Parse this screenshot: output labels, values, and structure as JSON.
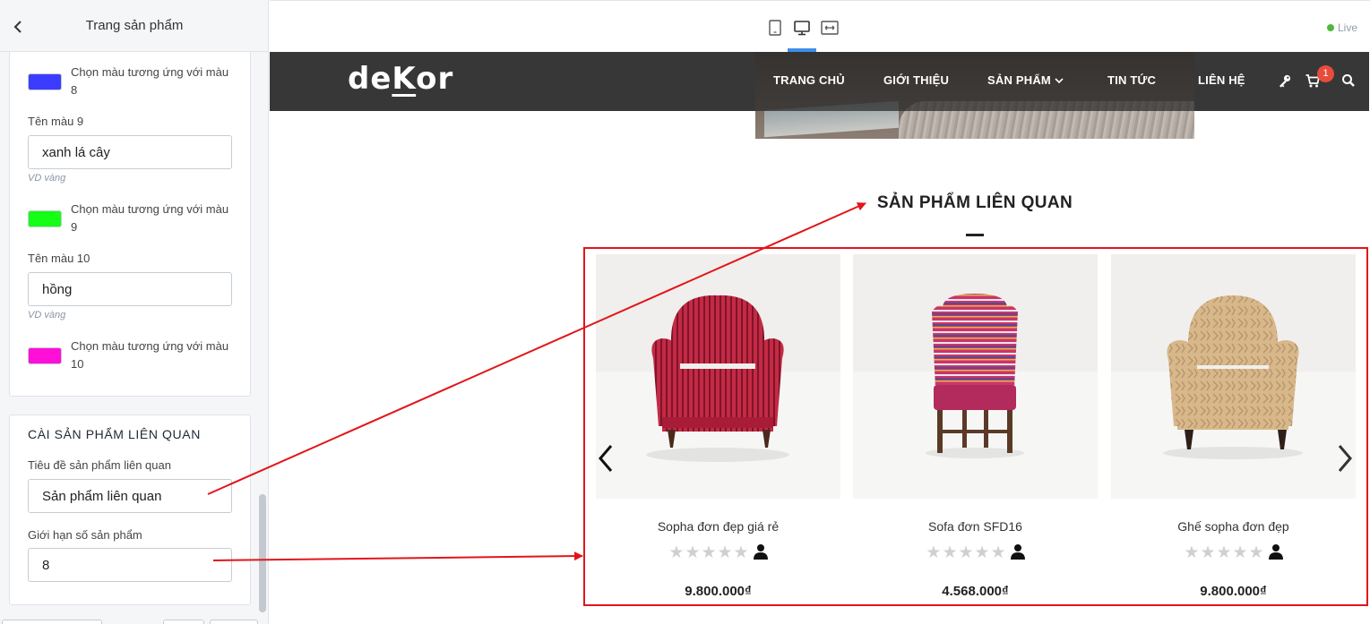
{
  "editor": {
    "header_title": "Trang sản phẩm",
    "color_rows": [
      {
        "swatch_color": "#3c3cff",
        "pick_label": "Chọn màu tương ứng với màu 8"
      },
      {
        "name_label": "Tên màu 9",
        "name_value": "xanh lá cây",
        "hint": "VD vàng",
        "swatch_color": "#14ff14",
        "pick_label": "Chọn màu tương ứng với màu 9"
      },
      {
        "name_label": "Tên màu 10",
        "name_value": "hồng",
        "hint": "VD vàng",
        "swatch_color": "#ff0fd8",
        "pick_label": "Chọn màu tương ứng với màu 10"
      }
    ],
    "related_section": {
      "heading": "CÀI SẢN PHẨM LIÊN QUAN",
      "title_label": "Tiêu đề sản phẩm liên quan",
      "title_value": "Sản phẩm liên quan",
      "limit_label": "Giới hạn số sản phẩm",
      "limit_value": "8"
    }
  },
  "toolbar": {
    "live_label": "Live",
    "device_icons": [
      "mobile-icon",
      "desktop-icon",
      "fullwidth-icon"
    ],
    "active_device": "desktop"
  },
  "store": {
    "logo": {
      "prefix": "de",
      "accent": "K",
      "suffix": "or"
    },
    "nav": [
      "TRANG CHỦ",
      "GIỚI THIỆU",
      "SẢN PHẨM",
      "TIN TỨC",
      "LIÊN HỆ"
    ],
    "cart_count": "1",
    "related_title": "SẢN PHẨM LIÊN QUAN",
    "products": [
      {
        "name": "Sopha đơn đẹp giá rẻ",
        "price": "9.800.000₫",
        "stars": 0
      },
      {
        "name": "Sofa đơn SFD16",
        "price": "4.568.000₫",
        "stars": 0
      },
      {
        "name": "Ghế sopha đơn đẹp",
        "price": "9.800.000₫",
        "stars": 0
      }
    ]
  },
  "colors": {
    "annotation": "#e3151a",
    "nav_bg": "#373737",
    "accent_blue": "#3d8ee8",
    "live_green": "#50b83c"
  }
}
